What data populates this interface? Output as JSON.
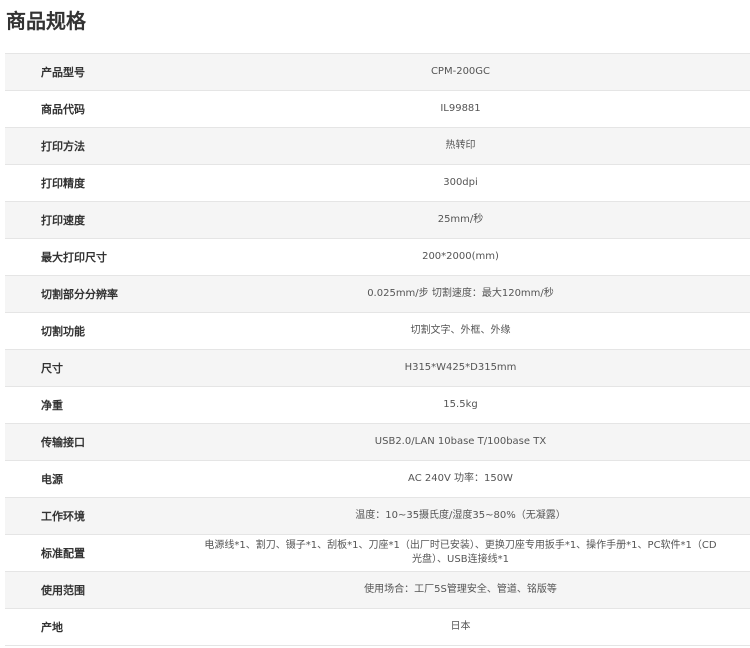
{
  "title": "商品规格",
  "specs": [
    {
      "label": "产品型号",
      "value": "CPM-200GC"
    },
    {
      "label": "商品代码",
      "value": "IL99881"
    },
    {
      "label": "打印方法",
      "value": "热转印"
    },
    {
      "label": "打印精度",
      "value": "300dpi"
    },
    {
      "label": "打印速度",
      "value": "25mm/秒"
    },
    {
      "label": "最大打印尺寸",
      "value": "200*2000(mm)"
    },
    {
      "label": "切割部分分辨率",
      "value": "0.025mm/步 切割速度：最大120mm/秒"
    },
    {
      "label": "切割功能",
      "value": "切割文字、外框、外缘"
    },
    {
      "label": "尺寸",
      "value": "H315*W425*D315mm"
    },
    {
      "label": "净重",
      "value": "15.5kg"
    },
    {
      "label": "传输接口",
      "value": "USB2.0/LAN 10base T/100base TX"
    },
    {
      "label": "电源",
      "value": "AC 240V 功率：150W"
    },
    {
      "label": "工作环境",
      "value": "温度：10~35摄氏度/湿度35~80%（无凝露）"
    },
    {
      "label": "标准配置",
      "value": "电源线*1、割刀、镊子*1、刮板*1、刀座*1（出厂时已安装）、更换刀座专用扳手*1、操作手册*1、PC软件*1（CD光盘）、USB连接线*1"
    },
    {
      "label": "使用范围",
      "value": "使用场合：工厂5S管理安全、管道、铭版等"
    },
    {
      "label": "产地",
      "value": "日本"
    }
  ]
}
